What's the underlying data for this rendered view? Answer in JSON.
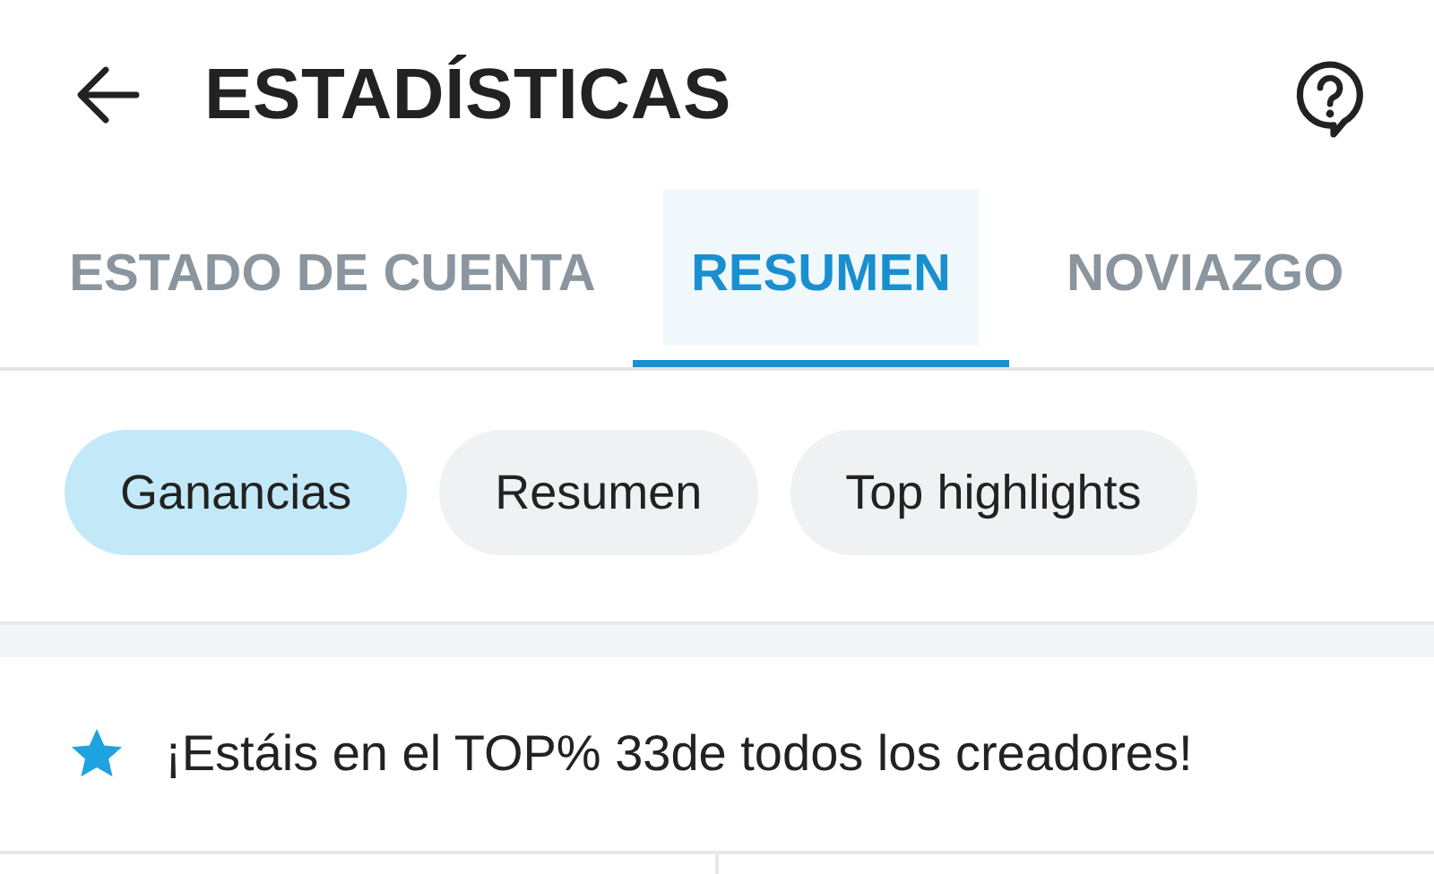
{
  "header": {
    "title": "ESTADÍSTICAS"
  },
  "tabs": [
    {
      "label": "ESTADO DE CUENTA",
      "selected": false
    },
    {
      "label": "RESUMEN",
      "selected": true
    },
    {
      "label": "NOVIAZGO",
      "selected": false
    }
  ],
  "chips": [
    {
      "label": "Ganancias",
      "selected": true
    },
    {
      "label": "Resumen",
      "selected": false
    },
    {
      "label": "Top highlights",
      "selected": false
    }
  ],
  "banner": {
    "text": "¡Estáis en el TOP% 33de todos los creadores!"
  }
}
